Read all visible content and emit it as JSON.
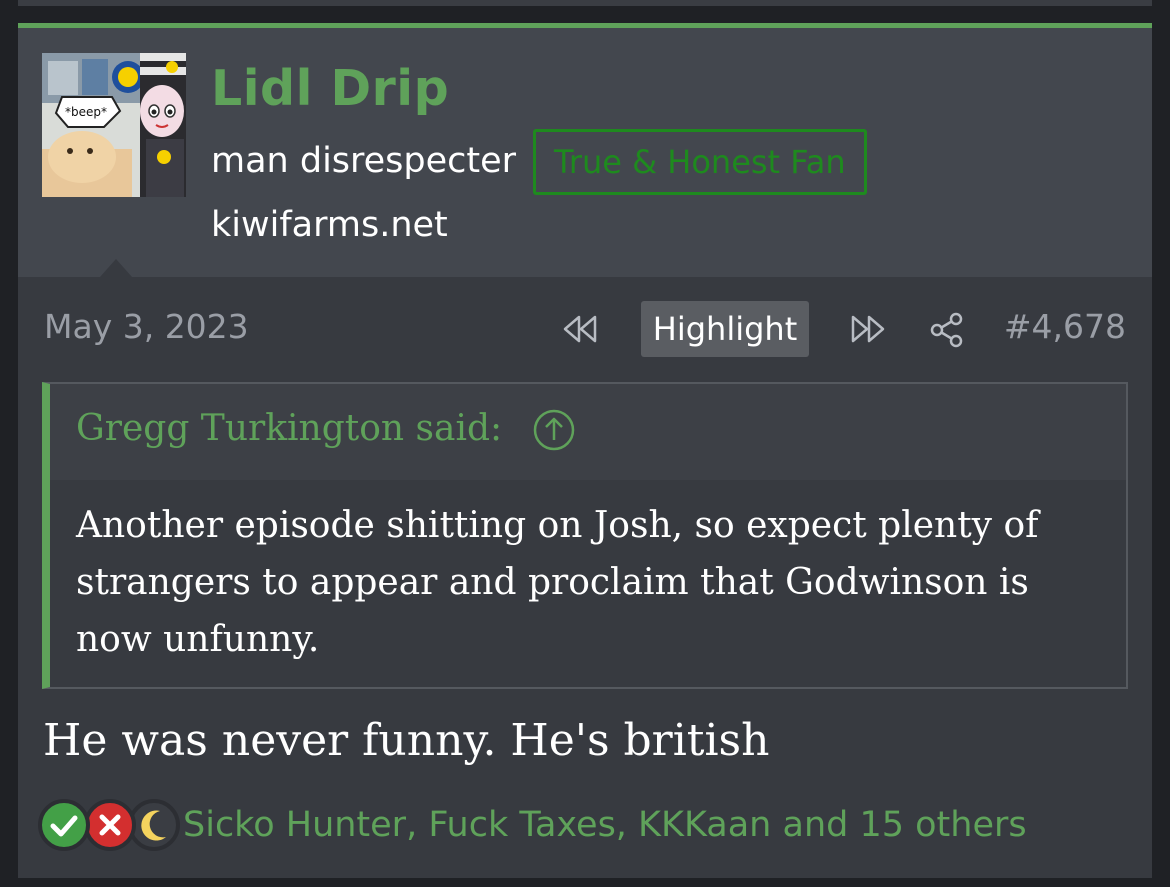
{
  "post": {
    "username": "Lidl Drip",
    "user_title": "man disrespecter",
    "user_badge": "True & Honest Fan",
    "user_site": "kiwifarms.net",
    "avatar_text": "*beep*",
    "date": "May 3, 2023",
    "highlight_label": "Highlight",
    "post_number": "#4,678",
    "quote": {
      "author": "Gregg Turkington said:",
      "body": "Another episode shitting on Josh, so expect plenty of strangers to appear and proclaim that Godwinson is now unfunny."
    },
    "message": "He was never funny. He's british",
    "reactions": {
      "icons": [
        "check-icon",
        "cross-icon",
        "moon-icon"
      ],
      "users_text": "Sicko Hunter, Fuck Taxes, KKKaan and 15 others"
    }
  },
  "colors": {
    "accent": "#5fa25a",
    "badge": "#1e8a1e",
    "background": "#373a40",
    "userbar": "#43474e"
  }
}
